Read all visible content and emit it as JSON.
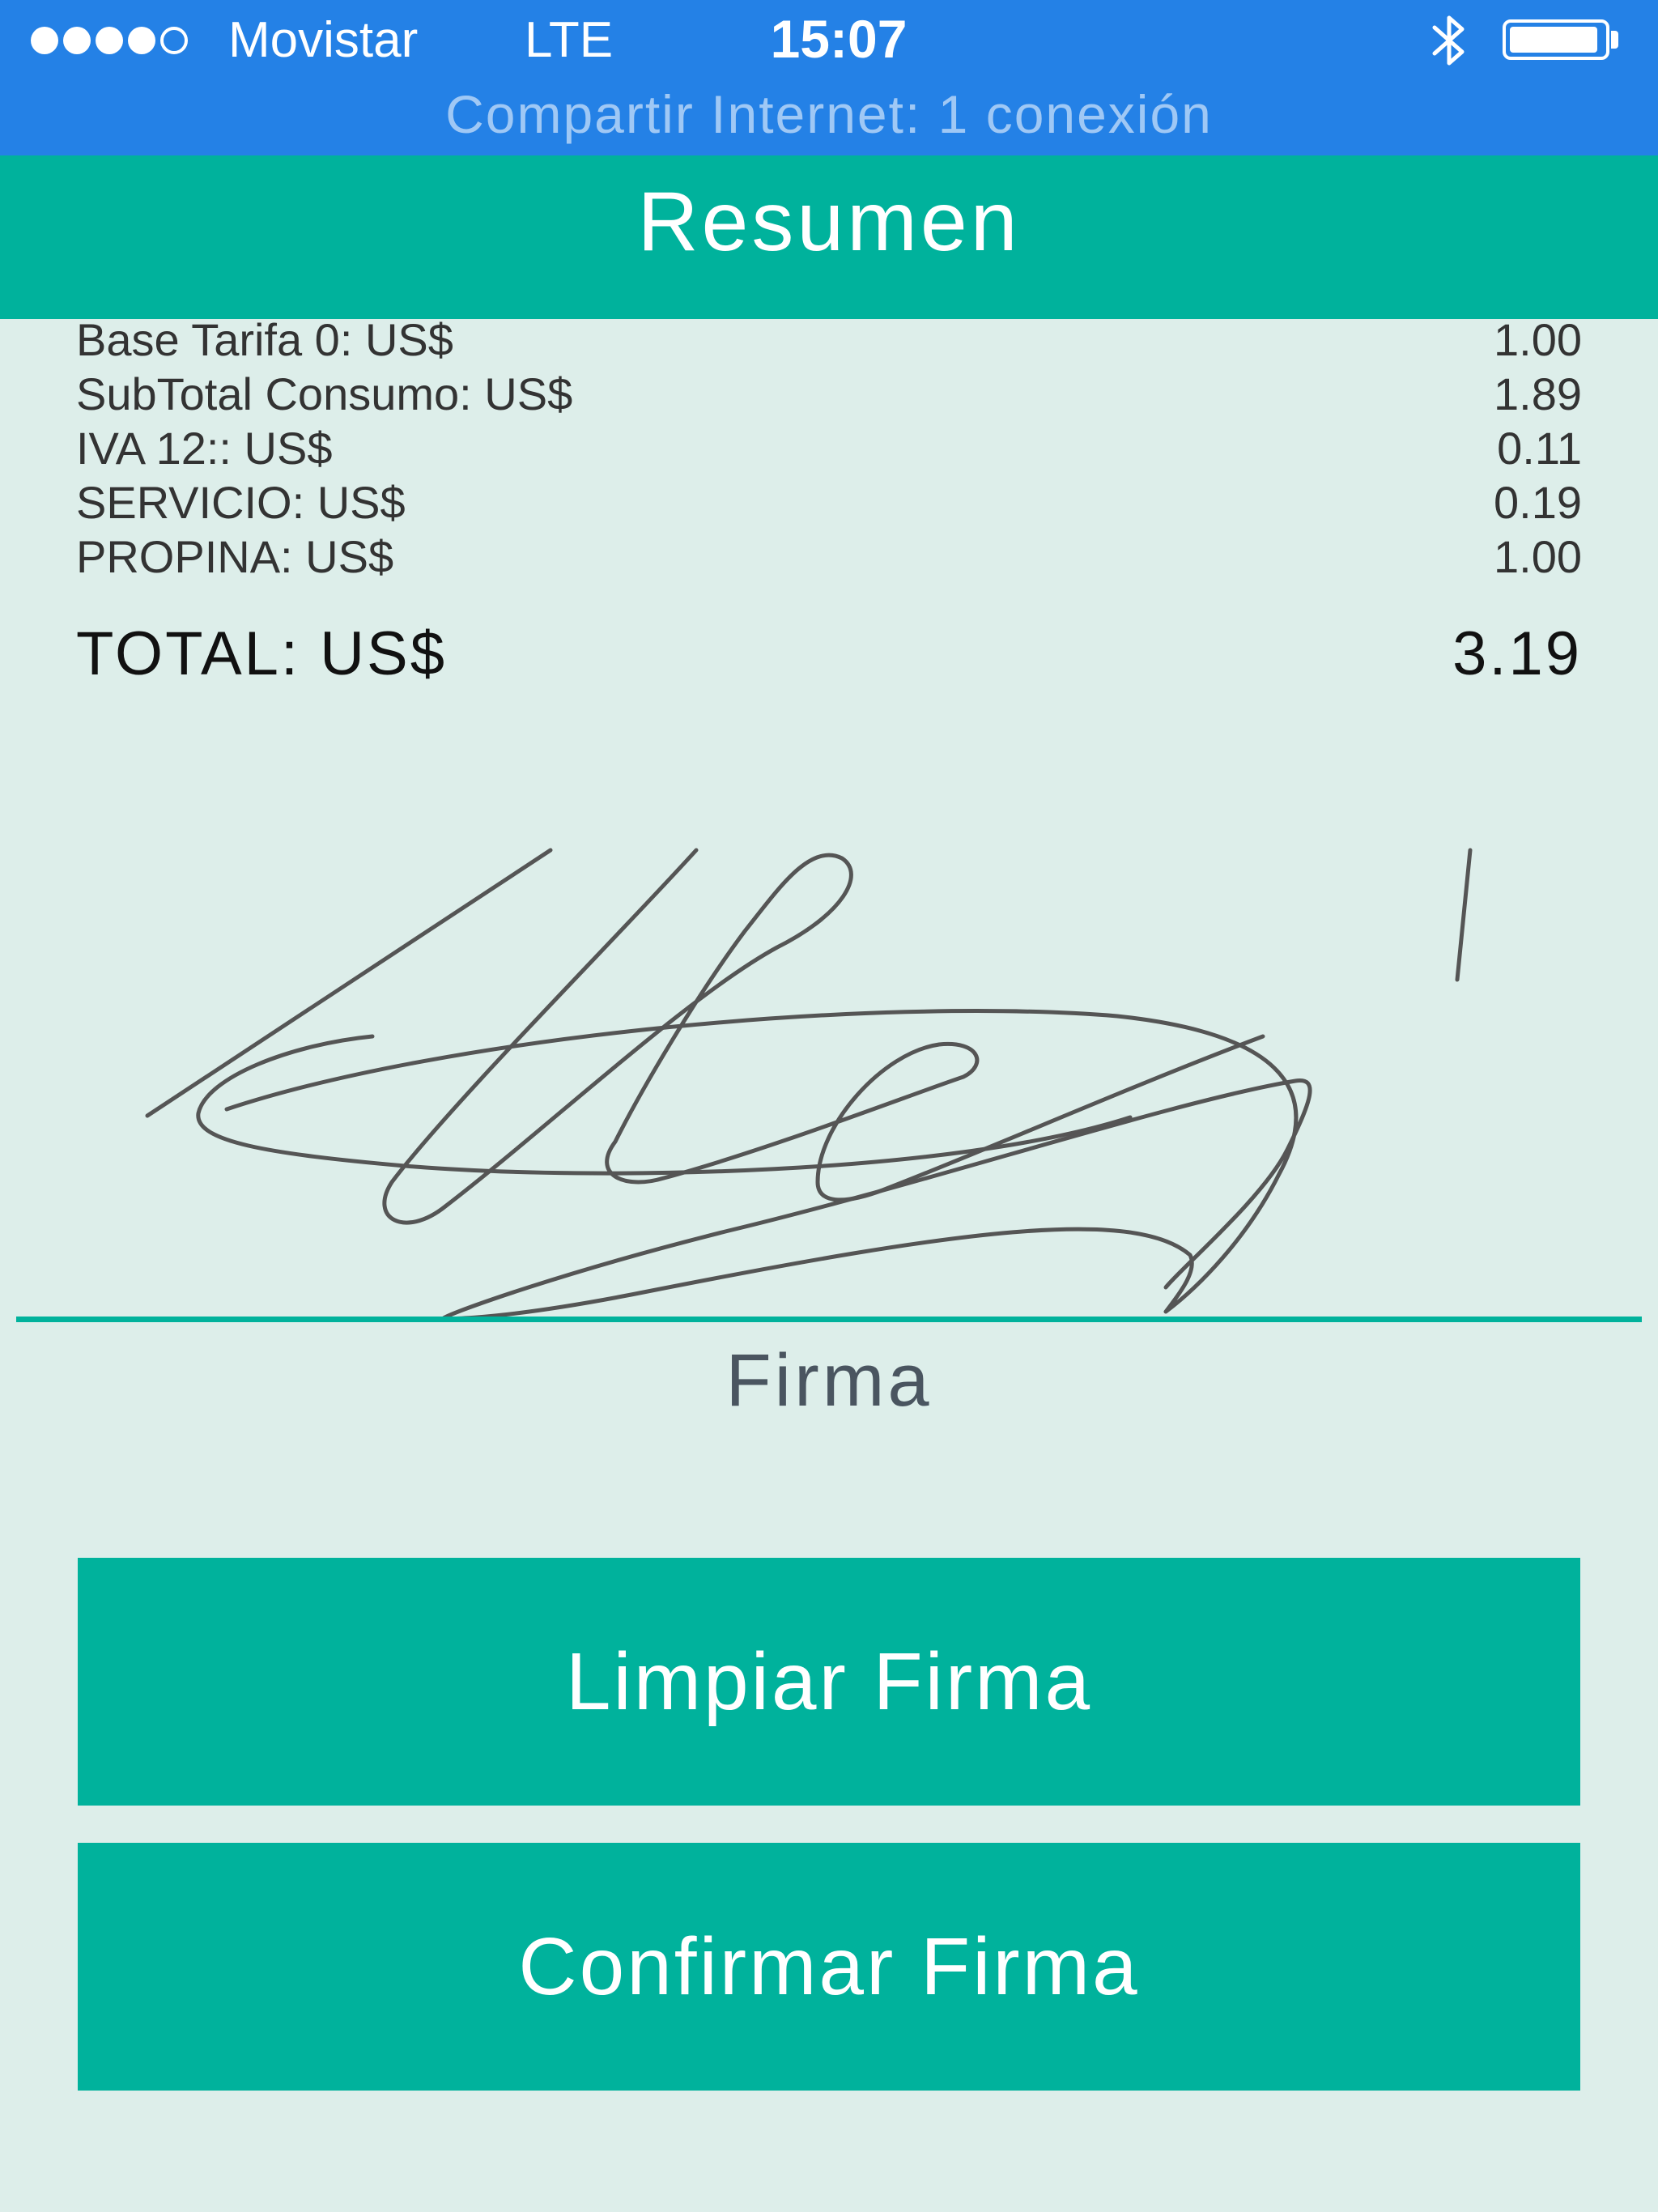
{
  "status_bar": {
    "carrier": "Movistar",
    "network": "LTE",
    "time": "15:07",
    "hotspot": "Compartir Internet: 1 conexión",
    "signal_strength": 4,
    "signal_max": 5,
    "battery_level": 0.95,
    "colors": {
      "background": "#2481e6",
      "hotspot_text": "#9fc8f5"
    },
    "icons": [
      "signal-dots-icon",
      "bluetooth-icon",
      "battery-icon"
    ]
  },
  "header": {
    "title": "Resumen",
    "color": "#00b29c"
  },
  "summary": {
    "rows": [
      {
        "label": "Base Tarifa 0: US$",
        "value": "1.00"
      },
      {
        "label": "SubTotal Consumo: US$",
        "value": "1.89"
      },
      {
        "label": "IVA 12:: US$",
        "value": "0.11"
      },
      {
        "label": "SERVICIO: US$",
        "value": "0.19"
      },
      {
        "label": "PROPINA: US$",
        "value": "1.00"
      }
    ],
    "total": {
      "label": "TOTAL: US$",
      "value": "3.19"
    }
  },
  "signature": {
    "label": "Firma"
  },
  "buttons": {
    "clear": "Limpiar Firma",
    "confirm": "Confirmar Firma"
  },
  "colors": {
    "accent": "#00b29c",
    "page_background": "#ddeeea"
  }
}
